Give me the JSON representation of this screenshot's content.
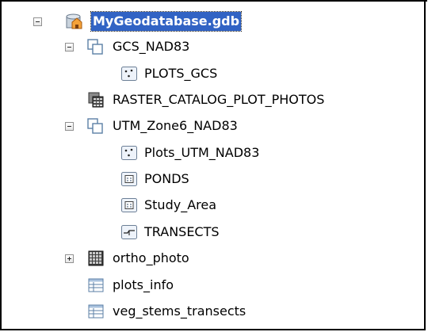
{
  "tree": {
    "root": {
      "label": "MyGeodatabase.gdb",
      "icon": "geodatabase-icon",
      "expander": "collapse"
    },
    "nodes": [
      {
        "label": "GCS_NAD83",
        "icon": "feature-dataset-icon",
        "expander": "collapse"
      },
      {
        "label": "PLOTS_GCS",
        "icon": "point-feature-class-icon"
      },
      {
        "label": "RASTER_CATALOG_PLOT_PHOTOS",
        "icon": "raster-catalog-icon"
      },
      {
        "label": "UTM_Zone6_NAD83",
        "icon": "feature-dataset-icon",
        "expander": "collapse"
      },
      {
        "label": "Plots_UTM_NAD83",
        "icon": "point-feature-class-icon"
      },
      {
        "label": "PONDS",
        "icon": "polygon-feature-class-icon"
      },
      {
        "label": "Study_Area",
        "icon": "polygon-feature-class-icon"
      },
      {
        "label": "TRANSECTS",
        "icon": "line-feature-class-icon"
      },
      {
        "label": "ortho_photo",
        "icon": "raster-dataset-icon",
        "expander": "expand"
      },
      {
        "label": "plots_info",
        "icon": "table-icon"
      },
      {
        "label": "veg_stems_transects",
        "icon": "table-icon"
      }
    ]
  }
}
